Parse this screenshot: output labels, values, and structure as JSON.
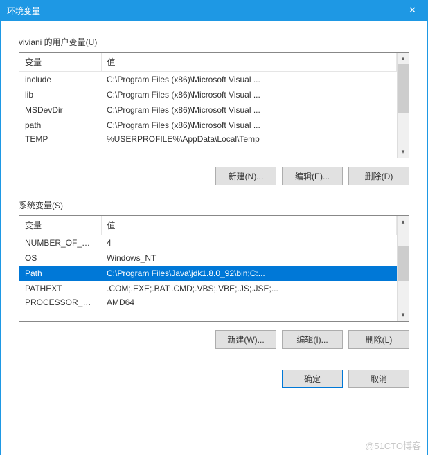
{
  "titlebar": {
    "title": "环境变量",
    "close": "✕"
  },
  "user_section": {
    "label": "viviani 的用户变量(U)",
    "headers": {
      "name": "变量",
      "value": "值"
    },
    "rows": [
      {
        "name": "include",
        "value": "C:\\Program Files (x86)\\Microsoft Visual ..."
      },
      {
        "name": "lib",
        "value": "C:\\Program Files (x86)\\Microsoft Visual ..."
      },
      {
        "name": "MSDevDir",
        "value": "C:\\Program Files (x86)\\Microsoft Visual ..."
      },
      {
        "name": "path",
        "value": "C:\\Program Files (x86)\\Microsoft Visual ..."
      },
      {
        "name": "TEMP",
        "value": "%USERPROFILE%\\AppData\\Local\\Temp"
      }
    ],
    "buttons": {
      "new": "新建(N)...",
      "edit": "编辑(E)...",
      "delete": "删除(D)"
    }
  },
  "system_section": {
    "label": "系统变量(S)",
    "headers": {
      "name": "变量",
      "value": "值"
    },
    "rows": [
      {
        "name": "NUMBER_OF_PR...",
        "value": "4",
        "selected": false
      },
      {
        "name": "OS",
        "value": "Windows_NT",
        "selected": false
      },
      {
        "name": "Path",
        "value": "C:\\Program Files\\Java\\jdk1.8.0_92\\bin;C:...",
        "selected": true
      },
      {
        "name": "PATHEXT",
        "value": ".COM;.EXE;.BAT;.CMD;.VBS;.VBE;.JS;.JSE;...",
        "selected": false
      },
      {
        "name": "PROCESSOR_AR...",
        "value": "AMD64",
        "selected": false
      }
    ],
    "buttons": {
      "new": "新建(W)...",
      "edit": "编辑(I)...",
      "delete": "删除(L)"
    }
  },
  "dialog_buttons": {
    "ok": "确定",
    "cancel": "取消"
  },
  "watermark": "@51CTO博客"
}
